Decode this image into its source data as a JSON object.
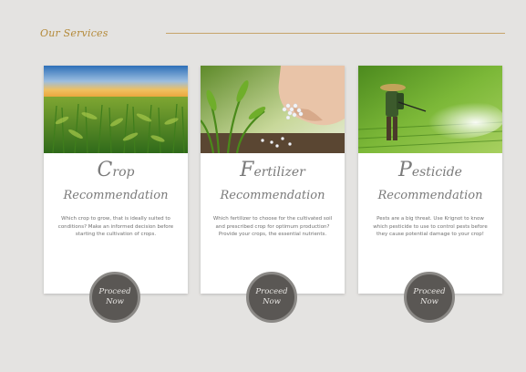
{
  "section": {
    "title": "Our Services"
  },
  "cards": [
    {
      "title_initial": "C",
      "title_rest": "rop",
      "title_line2": "Recommendation",
      "description": "Which crop to grow, that is ideally suited to conditions? Make an informed decision before starting the cultivation of crops.",
      "button_line1": "Proceed",
      "button_line2": "Now",
      "image": "corn-field-image"
    },
    {
      "title_initial": "F",
      "title_rest": "ertilizer",
      "title_line2": "Recommendation",
      "description": "Which fertilizer to choose for the cultivated soil and prescribed crop for optimum production? Provide your crops, the essential nutrients.",
      "button_line1": "Proceed",
      "button_line2": "Now",
      "image": "fertilizer-hand-image"
    },
    {
      "title_initial": "P",
      "title_rest": "esticide",
      "title_line2": "Recommendation",
      "description": "Pests are a big threat. Use Krignot to know which pesticide to use to control pests before they cause potential damage to your crop!",
      "button_line1": "Proceed",
      "button_line2": "Now",
      "image": "pesticide-spray-image"
    }
  ],
  "colors": {
    "background": "#e4e3e1",
    "accent_gold": "#b48a3a",
    "button_dark": "#5a5754",
    "text_gray": "#6f6f6f"
  }
}
